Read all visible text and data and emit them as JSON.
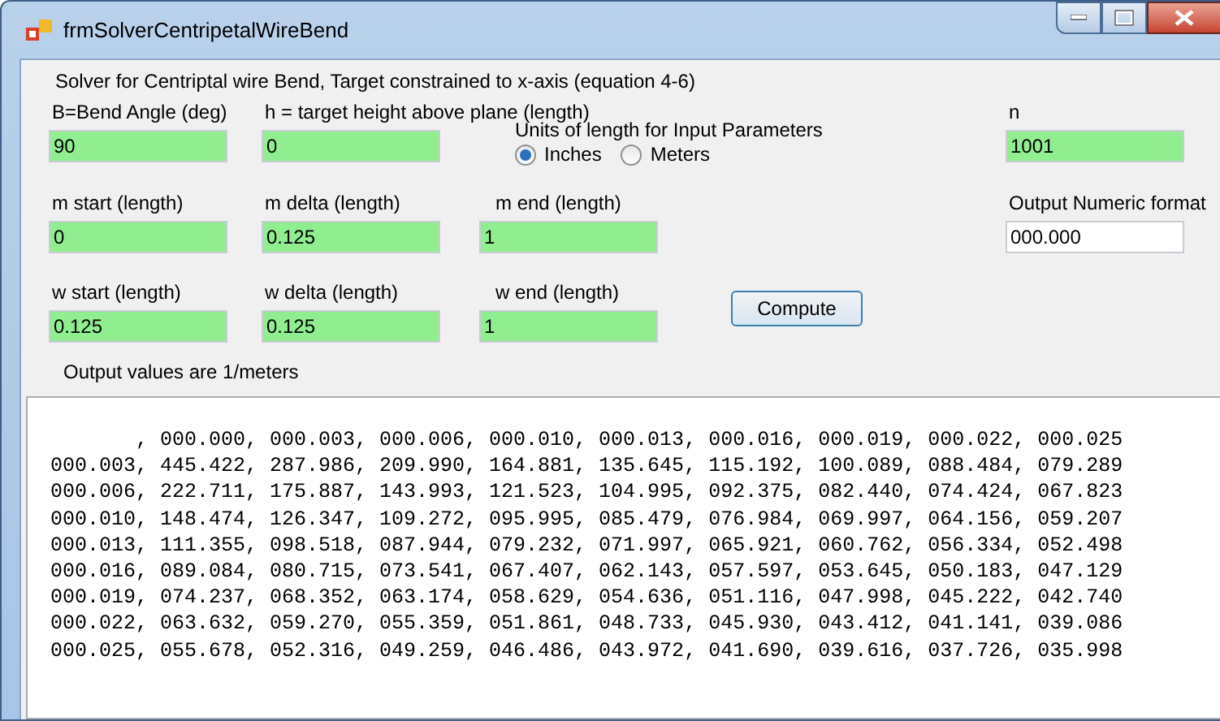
{
  "window": {
    "title": "frmSolverCentripetalWireBend"
  },
  "description": "Solver for Centriptal wire Bend, Target constrained to x-axis (equation 4-6)",
  "rows": [
    [
      {
        "label": "B=Bend Angle (deg)",
        "value": "90",
        "kind": "parameter"
      },
      {
        "label": "h = target height above plane (length)",
        "value": "0",
        "kind": "parameter"
      },
      {
        "kind": "units"
      },
      {
        "label": "n",
        "value": "1001",
        "kind": "parameter"
      }
    ],
    [
      {
        "label": "m start (length)",
        "value": "0",
        "kind": "parameter"
      },
      {
        "label": "m delta (length)",
        "value": "0.125",
        "kind": "parameter"
      },
      {
        "label": "m end (length)",
        "value": "1",
        "kind": "parameter"
      },
      {
        "label": "Output Numeric format",
        "value": "000.000",
        "kind": "format"
      }
    ],
    [
      {
        "label": "w start (length)",
        "value": "0.125",
        "kind": "parameter"
      },
      {
        "label": "w delta (length)",
        "value": "0.125",
        "kind": "parameter"
      },
      {
        "label": "w end (length)",
        "value": "1",
        "kind": "parameter"
      },
      {
        "kind": "button"
      }
    ]
  ],
  "units": {
    "label": "Units of length  for Input Parameters",
    "options": [
      {
        "label": "Inches",
        "selected": true
      },
      {
        "label": "Meters",
        "selected": false
      }
    ]
  },
  "compute_button": "Compute",
  "output_note": "Output values are 1/meters",
  "output_lines": [
    "       , 000.000, 000.003, 000.006, 000.010, 000.013, 000.016, 000.019, 000.022, 000.025",
    "000.003, 445.422, 287.986, 209.990, 164.881, 135.645, 115.192, 100.089, 088.484, 079.289",
    "000.006, 222.711, 175.887, 143.993, 121.523, 104.995, 092.375, 082.440, 074.424, 067.823",
    "000.010, 148.474, 126.347, 109.272, 095.995, 085.479, 076.984, 069.997, 064.156, 059.207",
    "000.013, 111.355, 098.518, 087.944, 079.232, 071.997, 065.921, 060.762, 056.334, 052.498",
    "000.016, 089.084, 080.715, 073.541, 067.407, 062.143, 057.597, 053.645, 050.183, 047.129",
    "000.019, 074.237, 068.352, 063.174, 058.629, 054.636, 051.116, 047.998, 045.222, 042.740",
    "000.022, 063.632, 059.270, 055.359, 051.861, 048.733, 045.930, 043.412, 041.141, 039.086",
    "000.025, 055.678, 052.316, 049.259, 046.486, 043.972, 041.690, 039.616, 037.726, 035.998"
  ]
}
